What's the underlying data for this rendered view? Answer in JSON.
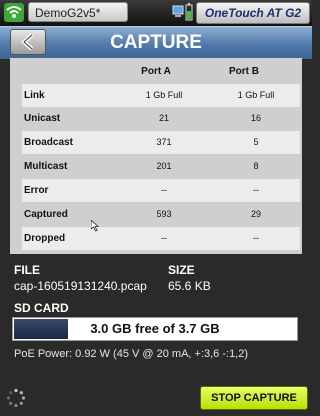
{
  "statusbar": {
    "wifi_icon": "wifi-icon",
    "profile_name": "DemoG2v5*",
    "status_icons": [
      "computer-icon",
      "battery-icon"
    ],
    "device_name": "OneTouch AT G2"
  },
  "header": {
    "back_icon": "back-arrow-icon",
    "title": "CAPTURE"
  },
  "table": {
    "columns": [
      "Port A",
      "Port B"
    ],
    "rows": [
      {
        "label": "Link",
        "a": "1 Gb Full",
        "b": "1 Gb Full"
      },
      {
        "label": "Unicast",
        "a": "21",
        "b": "16"
      },
      {
        "label": "Broadcast",
        "a": "371",
        "b": "5"
      },
      {
        "label": "Multicast",
        "a": "201",
        "b": "8"
      },
      {
        "label": "Error",
        "a": "--",
        "b": "--"
      },
      {
        "label": "Captured",
        "a": "593",
        "b": "29"
      },
      {
        "label": "Dropped",
        "a": "--",
        "b": "--"
      }
    ]
  },
  "file": {
    "file_label": "FILE",
    "file_name": "cap-160519131240.pcap",
    "size_label": "SIZE",
    "size_value": "65.6 KB"
  },
  "sdcard": {
    "label": "SD CARD",
    "free_text": "3.0 GB free of 3.7 GB",
    "used_fraction": 0.19
  },
  "poe": {
    "text": "PoE Power: 0.92 W (45 V @ 20 mA, +:3,6 -:1,2)"
  },
  "footer": {
    "spinner_icon": "busy-spinner-icon",
    "stop_button": "STOP CAPTURE"
  }
}
